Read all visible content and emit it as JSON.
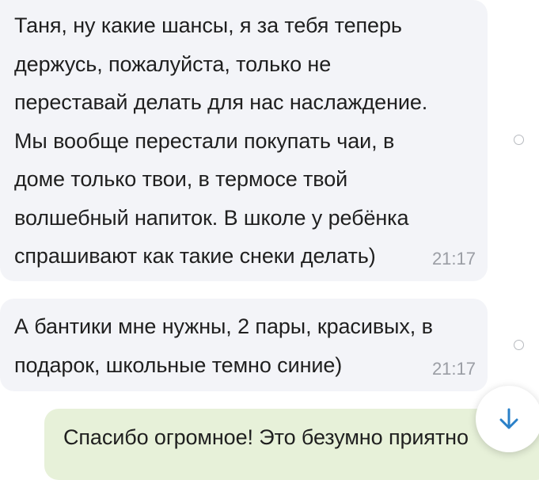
{
  "messages": [
    {
      "text": "Таня, ну какие шансы, я за тебя теперь\nдержусь, пожалуйста, только не\nпереставай делать для нас наслаждение.\nМы вообще перестали покупать чаи, в\nдоме только твои, в термосе твой\nволшебный напиток. В школе у ребёнка\nспрашивают как такие снеки делать)",
      "time": "21:17"
    },
    {
      "text": "А бантики мне нужны, 2 пары, красивых, в\nподарок, школьные темно синие)",
      "time": "21:17"
    },
    {
      "text": "Спасибо огромное! Это безумно приятно"
    }
  ],
  "icons": {
    "scroll_down": "arrow-down-icon",
    "select": "circle-outline-icon"
  },
  "colors": {
    "incoming_bubble": "#f3f4f8",
    "outgoing_bubble": "#e7f1d9",
    "time_text": "#9a9da4",
    "accent": "#2a80c8"
  }
}
